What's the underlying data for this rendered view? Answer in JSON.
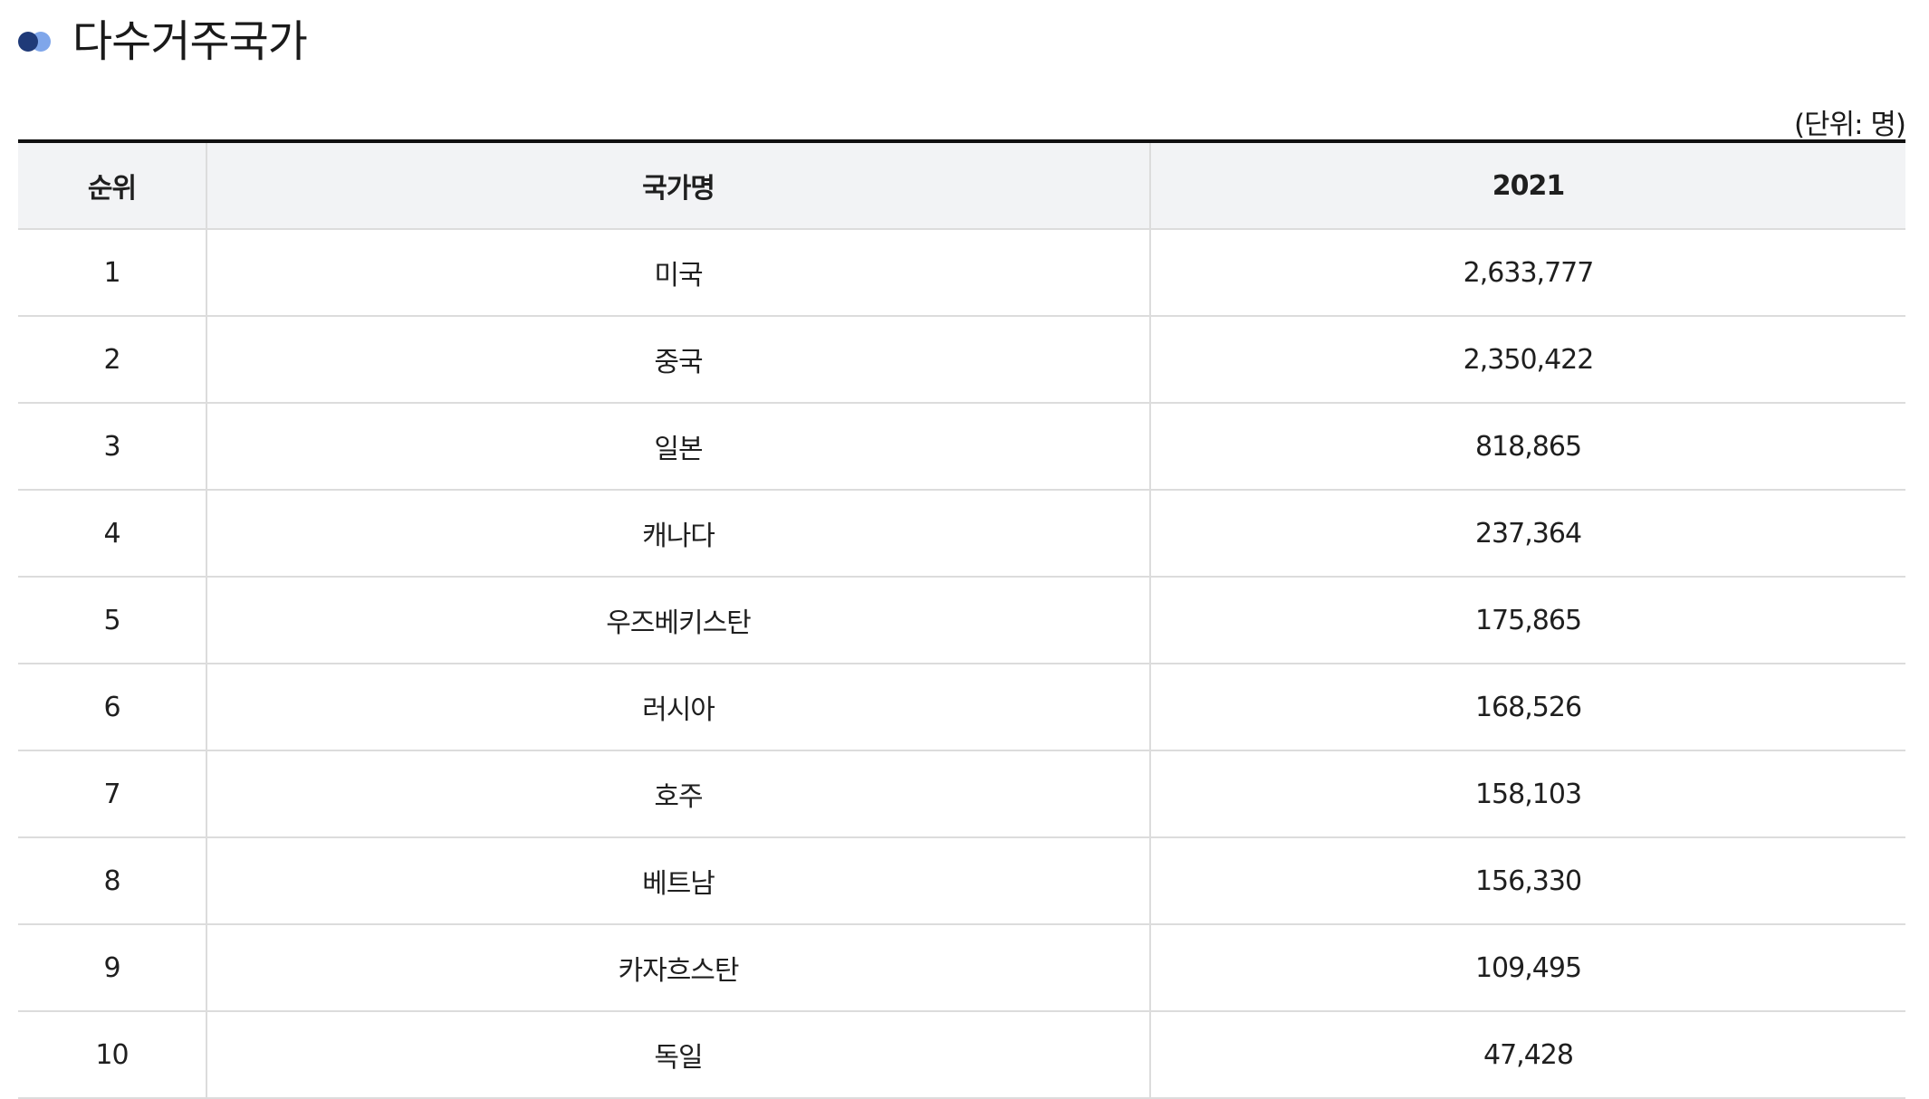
{
  "heading": {
    "title": "다수거주국가",
    "bullet_icon": "double-dot-icon"
  },
  "unit_label": "(단위: 명)",
  "table": {
    "headers": {
      "rank": "순위",
      "country": "국가명",
      "year": "2021"
    },
    "rows": [
      {
        "rank": "1",
        "country": "미국",
        "value": "2,633,777"
      },
      {
        "rank": "2",
        "country": "중국",
        "value": "2,350,422"
      },
      {
        "rank": "3",
        "country": "일본",
        "value": "818,865"
      },
      {
        "rank": "4",
        "country": "캐나다",
        "value": "237,364"
      },
      {
        "rank": "5",
        "country": "우즈베키스탄",
        "value": "175,865"
      },
      {
        "rank": "6",
        "country": "러시아",
        "value": "168,526"
      },
      {
        "rank": "7",
        "country": "호주",
        "value": "158,103"
      },
      {
        "rank": "8",
        "country": "베트남",
        "value": "156,330"
      },
      {
        "rank": "9",
        "country": "카자흐스탄",
        "value": "109,495"
      },
      {
        "rank": "10",
        "country": "독일",
        "value": "47,428"
      }
    ]
  },
  "colors": {
    "bullet_dark": "#1f3a78",
    "bullet_light": "#7fa6ea",
    "header_bg": "#f2f3f5",
    "top_rule": "#111111",
    "grid_line": "#dcdcdc"
  }
}
